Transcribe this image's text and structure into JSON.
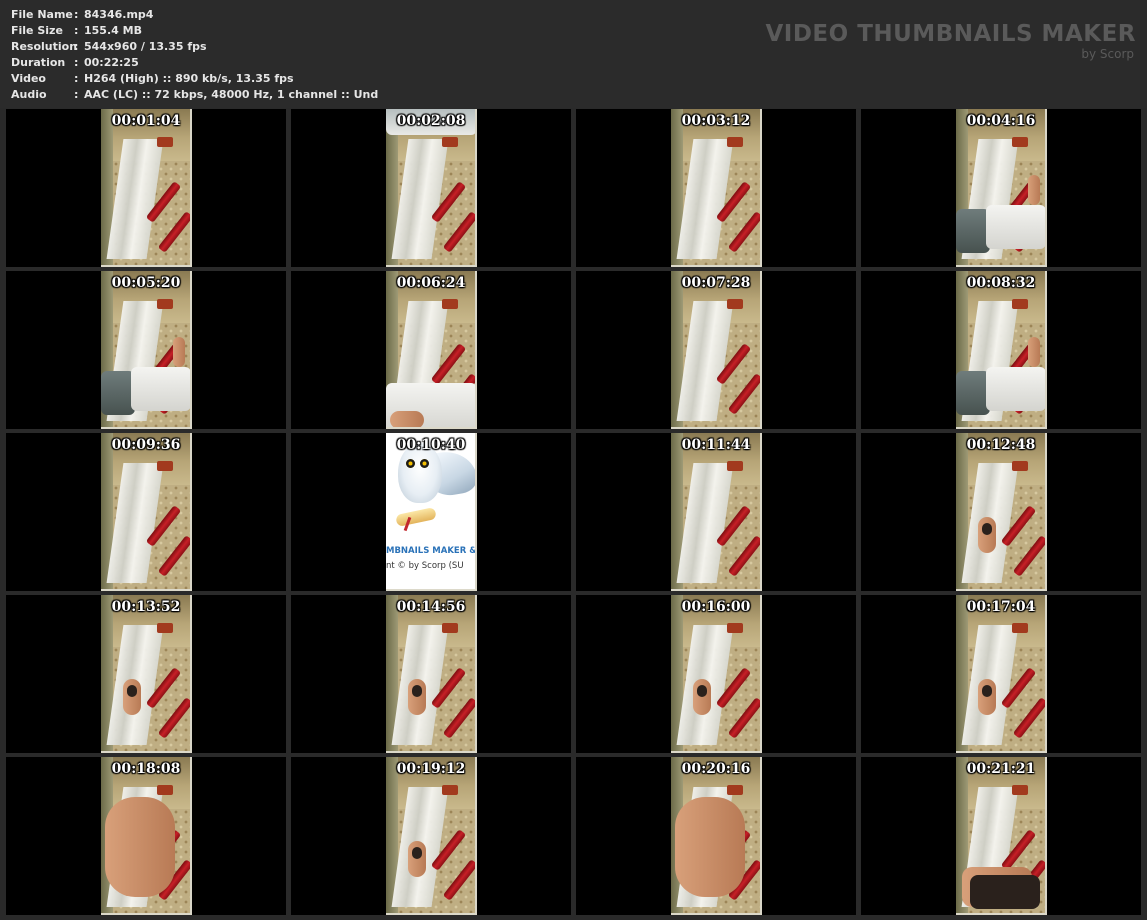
{
  "info": {
    "rows": [
      {
        "label": "File Name",
        "sep": ":",
        "value": "84346.mp4"
      },
      {
        "label": "File Size",
        "sep": ":",
        "value": "155.4 MB"
      },
      {
        "label": "Resolution",
        "sep": ":",
        "value": "544x960 / 13.35 fps"
      },
      {
        "label": "Duration",
        "sep": ":",
        "value": "00:22:25"
      },
      {
        "label": "Video",
        "sep": ":",
        "value": "H264 (High) :: 890 kb/s, 13.35 fps"
      },
      {
        "label": "Audio",
        "sep": ":",
        "value": "AAC (LC) :: 72 kbps, 48000 Hz, 1 channel :: Und"
      }
    ]
  },
  "brand": {
    "title": "VIDEO THUMBNAILS MAKER",
    "subtitle": "by Scorp"
  },
  "thumbnails": [
    {
      "time": "00:01:04",
      "scene": "room"
    },
    {
      "time": "00:02:08",
      "scene": "room-shirt-top"
    },
    {
      "time": "00:03:12",
      "scene": "room"
    },
    {
      "time": "00:04:16",
      "scene": "room-person"
    },
    {
      "time": "00:05:20",
      "scene": "room-person"
    },
    {
      "time": "00:06:24",
      "scene": "room-shirt-bottom"
    },
    {
      "time": "00:07:28",
      "scene": "room"
    },
    {
      "time": "00:08:32",
      "scene": "room-person"
    },
    {
      "time": "00:09:36",
      "scene": "room"
    },
    {
      "time": "00:10:40",
      "scene": "splash"
    },
    {
      "time": "00:11:44",
      "scene": "room"
    },
    {
      "time": "00:12:48",
      "scene": "room-figure"
    },
    {
      "time": "00:13:52",
      "scene": "room-figure"
    },
    {
      "time": "00:14:56",
      "scene": "room-figure"
    },
    {
      "time": "00:16:00",
      "scene": "room-figure"
    },
    {
      "time": "00:17:04",
      "scene": "room-figure"
    },
    {
      "time": "00:18:08",
      "scene": "room-skin"
    },
    {
      "time": "00:19:12",
      "scene": "room-figure"
    },
    {
      "time": "00:20:16",
      "scene": "room-skin"
    },
    {
      "time": "00:21:21",
      "scene": "room-dark"
    }
  ],
  "splash": {
    "title": "MBNAILS MAKER &",
    "copy": "nt © by Scorp (SU"
  },
  "colors": {
    "background": "#2b2b2b",
    "info_text": "#e6e6e6",
    "brand_text": "#5a5a5a",
    "cell_background": "#000000"
  }
}
